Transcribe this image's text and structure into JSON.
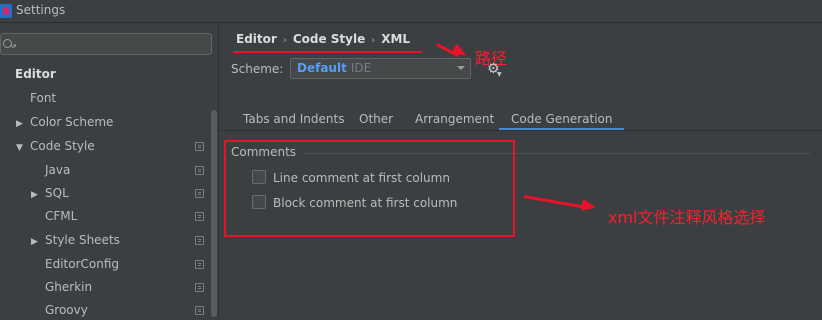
{
  "window": {
    "title": "Settings"
  },
  "sidebar": {
    "search_placeholder": "",
    "items": [
      {
        "label": "Editor",
        "expander": ""
      },
      {
        "label": "Font",
        "expander": ""
      },
      {
        "label": "Color Scheme",
        "expander": "▶"
      },
      {
        "label": "Code Style",
        "expander": "▼"
      },
      {
        "label": "Java",
        "expander": ""
      },
      {
        "label": "SQL",
        "expander": "▶"
      },
      {
        "label": "CFML",
        "expander": ""
      },
      {
        "label": "Style Sheets",
        "expander": "▶"
      },
      {
        "label": "EditorConfig",
        "expander": ""
      },
      {
        "label": "Gherkin",
        "expander": ""
      },
      {
        "label": "Groovy",
        "expander": ""
      }
    ]
  },
  "breadcrumb": {
    "items": [
      "Editor",
      "Code Style",
      "XML"
    ],
    "separator": "›"
  },
  "annotations": {
    "path_label": "路径",
    "comment_style_label": "xml文件注释风格选择",
    "color": "#e8132a"
  },
  "scheme": {
    "label": "Scheme:",
    "value": "Default",
    "sub": "IDE"
  },
  "tabs": [
    {
      "label": "Tabs and Indents",
      "active": false
    },
    {
      "label": "Other",
      "active": false
    },
    {
      "label": "Arrangement",
      "active": false
    },
    {
      "label": "Code Generation",
      "active": true
    }
  ],
  "comments": {
    "title": "Comments",
    "options": [
      {
        "label": "Line comment at first column",
        "checked": false
      },
      {
        "label": "Block comment at first column",
        "checked": false
      }
    ]
  },
  "colors": {
    "accent": "#4a88c7",
    "link": "#589df6",
    "background": "#3c3f41"
  }
}
